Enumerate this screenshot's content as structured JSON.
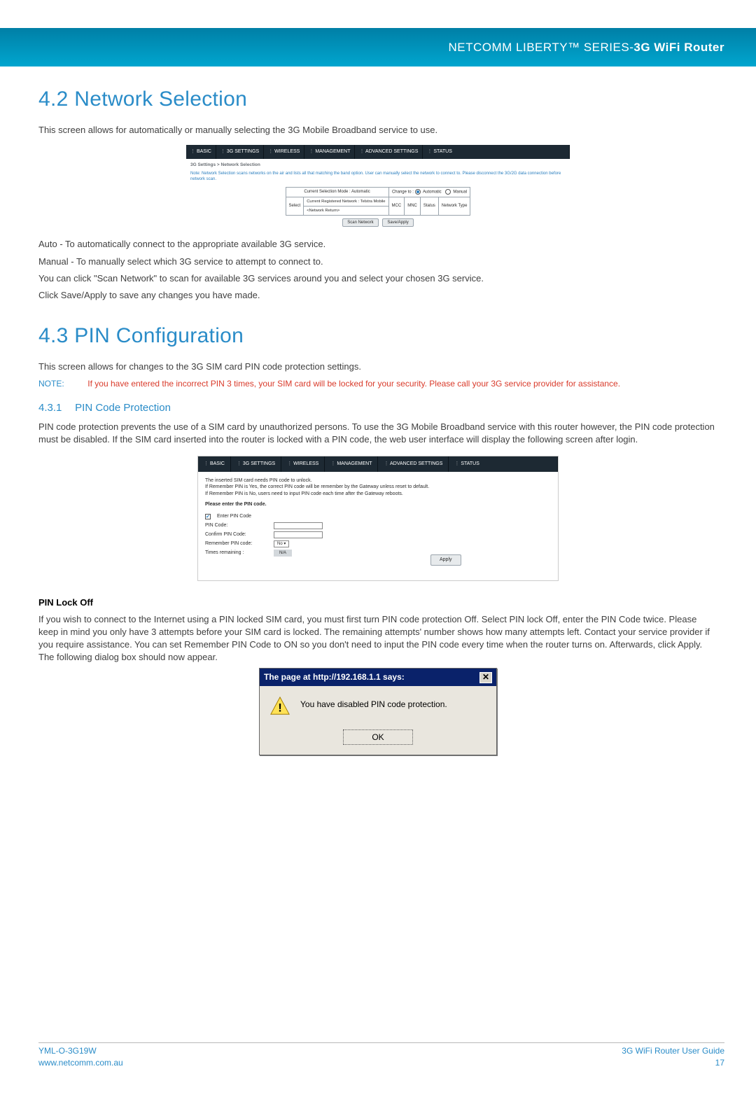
{
  "banner": {
    "left": "NETCOMM LIBERTY™ SERIES",
    "sep": " - ",
    "right": "3G WiFi Router"
  },
  "sections": {
    "s42": {
      "title": "4.2 Network Selection",
      "intro": "This screen allows for automatically or manually selecting the 3G Mobile Broadband service to use.",
      "p1": "Auto - To automatically connect to the appropriate available 3G service.",
      "p2": "Manual - To manually select which 3G service to attempt to connect to.",
      "p3": "You can click \"Scan Network\" to scan for available 3G services around you and select your chosen 3G service.",
      "p4": "Click Save/Apply to save any changes you have made."
    },
    "s43": {
      "title": "4.3 PIN Configuration",
      "intro": "This screen allows for changes to the 3G SIM card PIN code protection settings.",
      "note_label": "NOTE:",
      "note_text": "If you have entered the incorrect PIN 3 times, your SIM card will be locked for your security. Please call your 3G service provider for assistance.",
      "sub431_idx": "4.3.1",
      "sub431_title": "PIN Code Protection",
      "p_pcp": "PIN code protection prevents the use of a SIM card by unauthorized persons. To use the 3G Mobile Broadband service with this router however, the PIN code protection must be disabled. If the SIM card inserted into the router is locked with a PIN code, the web user interface will display the following screen after login.",
      "pinlock_title": "PIN Lock Off",
      "pinlock_body": "If you wish to connect to the Internet using a PIN locked SIM card, you must first turn PIN code protection Off. Select PIN lock Off, enter the PIN Code twice. Please keep in mind you only have 3 attempts before your SIM card is locked. The remaining attempts' number shows how many attempts left. Contact your service provider if you require assistance. You can set Remember PIN Code to ON so you don't need to input the PIN code every time when the router turns on. Afterwards, click Apply. The following dialog box should now appear."
    }
  },
  "nav_tabs": [
    "BASIC",
    "3G SETTINGS",
    "WIRELESS",
    "MANAGEMENT",
    "ADVANCED SETTINGS",
    "STATUS"
  ],
  "embed1": {
    "crumb": "3G Settings > Network Selection",
    "note": "Note: Network Selection scans networks on the air and lists all that matching the band option. User can manually select the network to connect to. Please disconnect the 3G/2G data connection before network scan.",
    "mode_label": "Current Selection Mode : Automatic",
    "change_label": "Change to :",
    "auto_label": "Automatic",
    "manual_label": "Manual",
    "cols": [
      "Select",
      "Current Registered Network : Telstra Mobile",
      "MCC",
      "MNC",
      "Status",
      "Network Type"
    ],
    "row2": "<Network Return>",
    "btn_scan": "Scan Network",
    "btn_save": "Save/Apply"
  },
  "embed2": {
    "l1": "The inserted SIM card needs PIN code to unlock.",
    "l2": "If Remember PIN is Yes, the correct PIN code will be remember by the Gateway unless reset to default.",
    "l3": "If Remember PIN is No, users need to input PIN code each time after the Gateway reboots.",
    "l4": "Please enter the PIN code.",
    "enter_pin": "Enter PIN Code",
    "pin_code": "PIN Code:",
    "confirm_pin": "Confirm PIN Code:",
    "remember": "Remember PIN code:",
    "remember_value": "No",
    "remaining": "Times remaining :",
    "remaining_value": "N/A",
    "apply": "Apply"
  },
  "dialog": {
    "title": "The page at http://192.168.1.1 says:",
    "message": "You have disabled PIN code protection.",
    "ok": "OK"
  },
  "footer": {
    "code": "YML-O-3G19W",
    "url": "www.netcomm.com.au",
    "guide": "3G WiFi Router User Guide",
    "page": "17"
  }
}
